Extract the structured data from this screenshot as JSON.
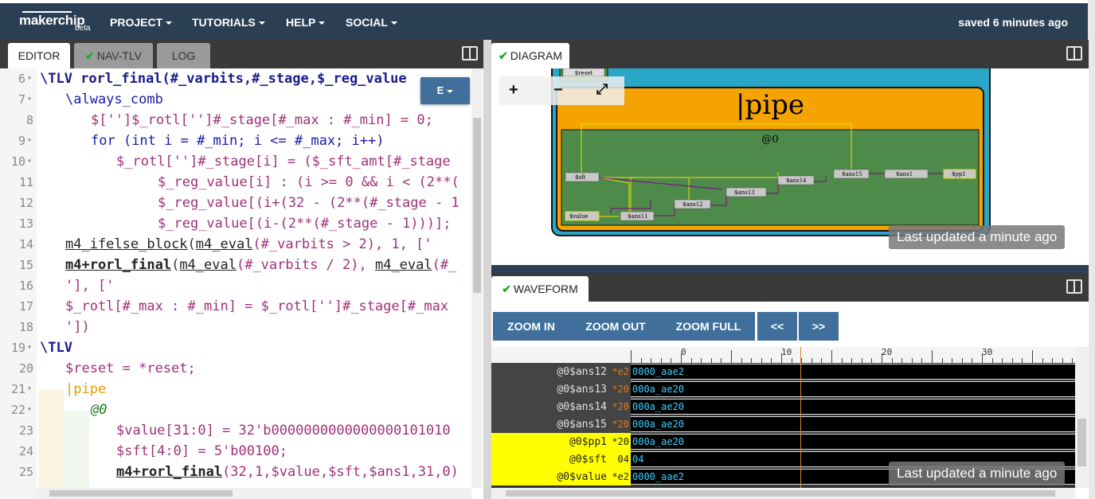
{
  "app": {
    "brand": "makerchip",
    "beta": "beta",
    "menus": [
      "PROJECT",
      "TUTORIALS",
      "HELP",
      "SOCIAL"
    ],
    "saved": "saved 6 minutes ago"
  },
  "editor_tabs": [
    {
      "label": "EDITOR",
      "checked": false,
      "active": true
    },
    {
      "label": "NAV-TLV",
      "checked": true,
      "active": false
    },
    {
      "label": "LOG",
      "checked": false,
      "active": false
    }
  ],
  "diagram_tab": "DIAGRAM",
  "waveform_tab": "WAVEFORM",
  "editor_button": "E",
  "code_lines": [
    {
      "n": "6",
      "fold": true
    },
    {
      "n": "7",
      "fold": true
    },
    {
      "n": "8",
      "fold": false
    },
    {
      "n": "9",
      "fold": true
    },
    {
      "n": "10",
      "fold": true
    },
    {
      "n": "11",
      "fold": false
    },
    {
      "n": "12",
      "fold": false
    },
    {
      "n": "13",
      "fold": false
    },
    {
      "n": "14",
      "fold": false
    },
    {
      "n": "15",
      "fold": false
    },
    {
      "n": "16",
      "fold": false
    },
    {
      "n": "17",
      "fold": false
    },
    {
      "n": "18",
      "fold": false
    },
    {
      "n": "19",
      "fold": true
    },
    {
      "n": "20",
      "fold": false
    },
    {
      "n": "21",
      "fold": true
    },
    {
      "n": "22",
      "fold": true
    },
    {
      "n": "23",
      "fold": false
    },
    {
      "n": "24",
      "fold": false
    },
    {
      "n": "25",
      "fold": false
    }
  ],
  "code_text": {
    "l6_kw": "\\TLV",
    "l6_rest": " rorl_final(#_varbits,#_stage,$_reg_value",
    "l7": "\\always_comb",
    "l8": "$['']$_rotl['']#_stage[#_max : #_min] = 0;",
    "l9_kw": "for",
    "l9_rest": " (int i = #_min; i <= #_max; i++)",
    "l10": "$_rotl['']#_stage[i] = ($_sft_amt[#_stage",
    "l11": "$_reg_value[i] : (i >= 0 && i < (2**(",
    "l12": "$_reg_value[(i+(32 - (2**(#_stage - 1",
    "l13": "$_reg_value[(i-(2**(#_stage - 1)))];",
    "l14_a": "m4_ifelse_block",
    "l14_b": "(",
    "l14_c": "m4_eval",
    "l14_d": "(#_varbits > 2), 1, ['",
    "l15_a": "m4+rorl_final",
    "l15_b": "(",
    "l15_c": "m4_eval",
    "l15_d": "(#_varbits / 2), ",
    "l15_e": "m4_eval",
    "l15_f": "(#_",
    "l16": "'], ['",
    "l17": "$_rotl[#_max : #_min] = $_rotl['']#_stage[#_max",
    "l18": "'])",
    "l19": "\\TLV",
    "l20": "$reset = *reset;",
    "l21": "|pipe",
    "l22": "@0",
    "l23": "$value[31:0] = 32'b0000000000000000101010",
    "l24": "$sft[4:0] = 5'b00100;",
    "l25_a": "m4+rorl_final",
    "l25_b": "(32,1,$value,$sft,$ans1,31,0)"
  },
  "diagram": {
    "zoom_in": "+",
    "zoom_out": "−",
    "fullscreen": "⤢",
    "reset_label": "$reset",
    "pipe_label": "|pipe",
    "stage_label": "@0",
    "nodes": [
      "$sft",
      "$value",
      "$ans11",
      "$ans12",
      "$ans13",
      "$ans14",
      "$ans15",
      "$ans1",
      "$pp1"
    ],
    "last_updated": "Last updated a minute ago"
  },
  "waveform": {
    "buttons": [
      "ZOOM IN",
      "ZOOM OUT",
      "ZOOM FULL"
    ],
    "nav": [
      "<<",
      ">>"
    ],
    "ruler": [
      "0",
      "10",
      "20",
      "30"
    ],
    "signals": [
      {
        "name": "@0$ans12",
        "val": "*e2",
        "trace": "0000_aae2",
        "highlight": false
      },
      {
        "name": "@0$ans13",
        "val": "*20",
        "trace": "000a_ae20",
        "highlight": false
      },
      {
        "name": "@0$ans14",
        "val": "*20",
        "trace": "000a_ae20",
        "highlight": false
      },
      {
        "name": "@0$ans15",
        "val": "*20",
        "trace": "000a_ae20",
        "highlight": false
      },
      {
        "name": "@0$pp1",
        "val": "*20",
        "trace": "000a_ae20",
        "highlight": true
      },
      {
        "name": "@0$sft",
        "val": "04",
        "trace": "04",
        "highlight": true
      },
      {
        "name": "@0$value",
        "val": "*e2",
        "trace": "0000_aae2",
        "highlight": true
      }
    ],
    "last_updated": "Last updated a minute ago"
  },
  "colors": {
    "nav": "#2b3f54",
    "button": "#3f6f9a",
    "pipe": "#f5a300",
    "stage": "#4e8a4a",
    "highlight": "#ffff00"
  }
}
